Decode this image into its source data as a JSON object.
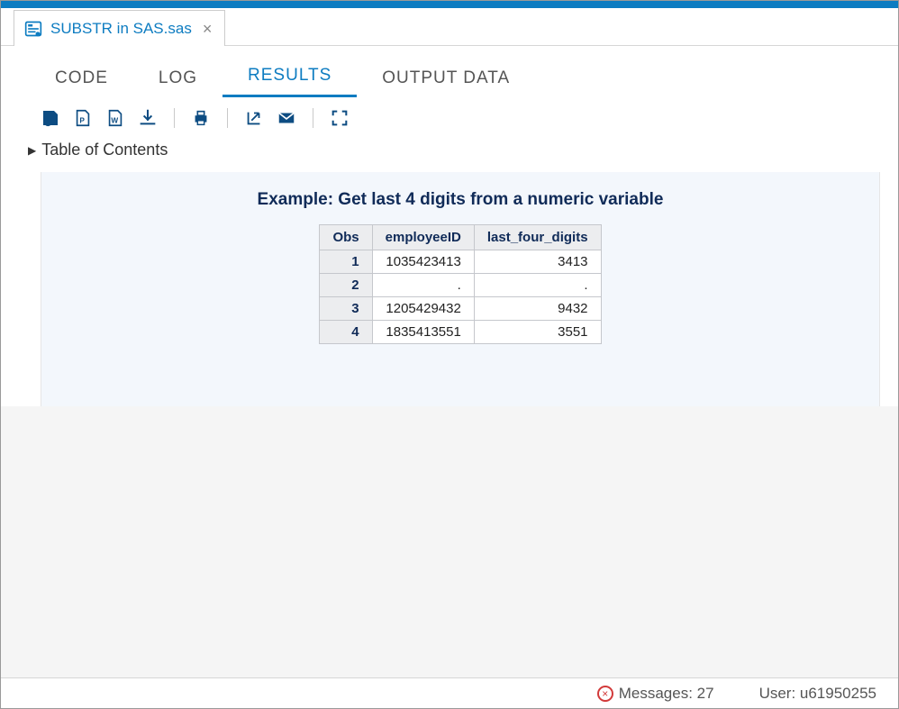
{
  "file_tab": {
    "label": "SUBSTR in SAS.sas"
  },
  "subtabs": {
    "code": "CODE",
    "log": "LOG",
    "results": "RESULTS",
    "output_data": "OUTPUT DATA",
    "active": "results"
  },
  "toc": {
    "label": "Table of Contents"
  },
  "results": {
    "title": "Example: Get last 4 digits from a numeric variable",
    "columns": {
      "obs": "Obs",
      "employeeID": "employeeID",
      "last_four_digits": "last_four_digits"
    },
    "rows": [
      {
        "obs": "1",
        "employeeID": "1035423413",
        "last_four_digits": "3413"
      },
      {
        "obs": "2",
        "employeeID": ".",
        "last_four_digits": "."
      },
      {
        "obs": "3",
        "employeeID": "1205429432",
        "last_four_digits": "9432"
      },
      {
        "obs": "4",
        "employeeID": "1835413551",
        "last_four_digits": "3551"
      }
    ]
  },
  "status": {
    "messages_label": "Messages: 27",
    "user_label": "User: u61950255"
  }
}
